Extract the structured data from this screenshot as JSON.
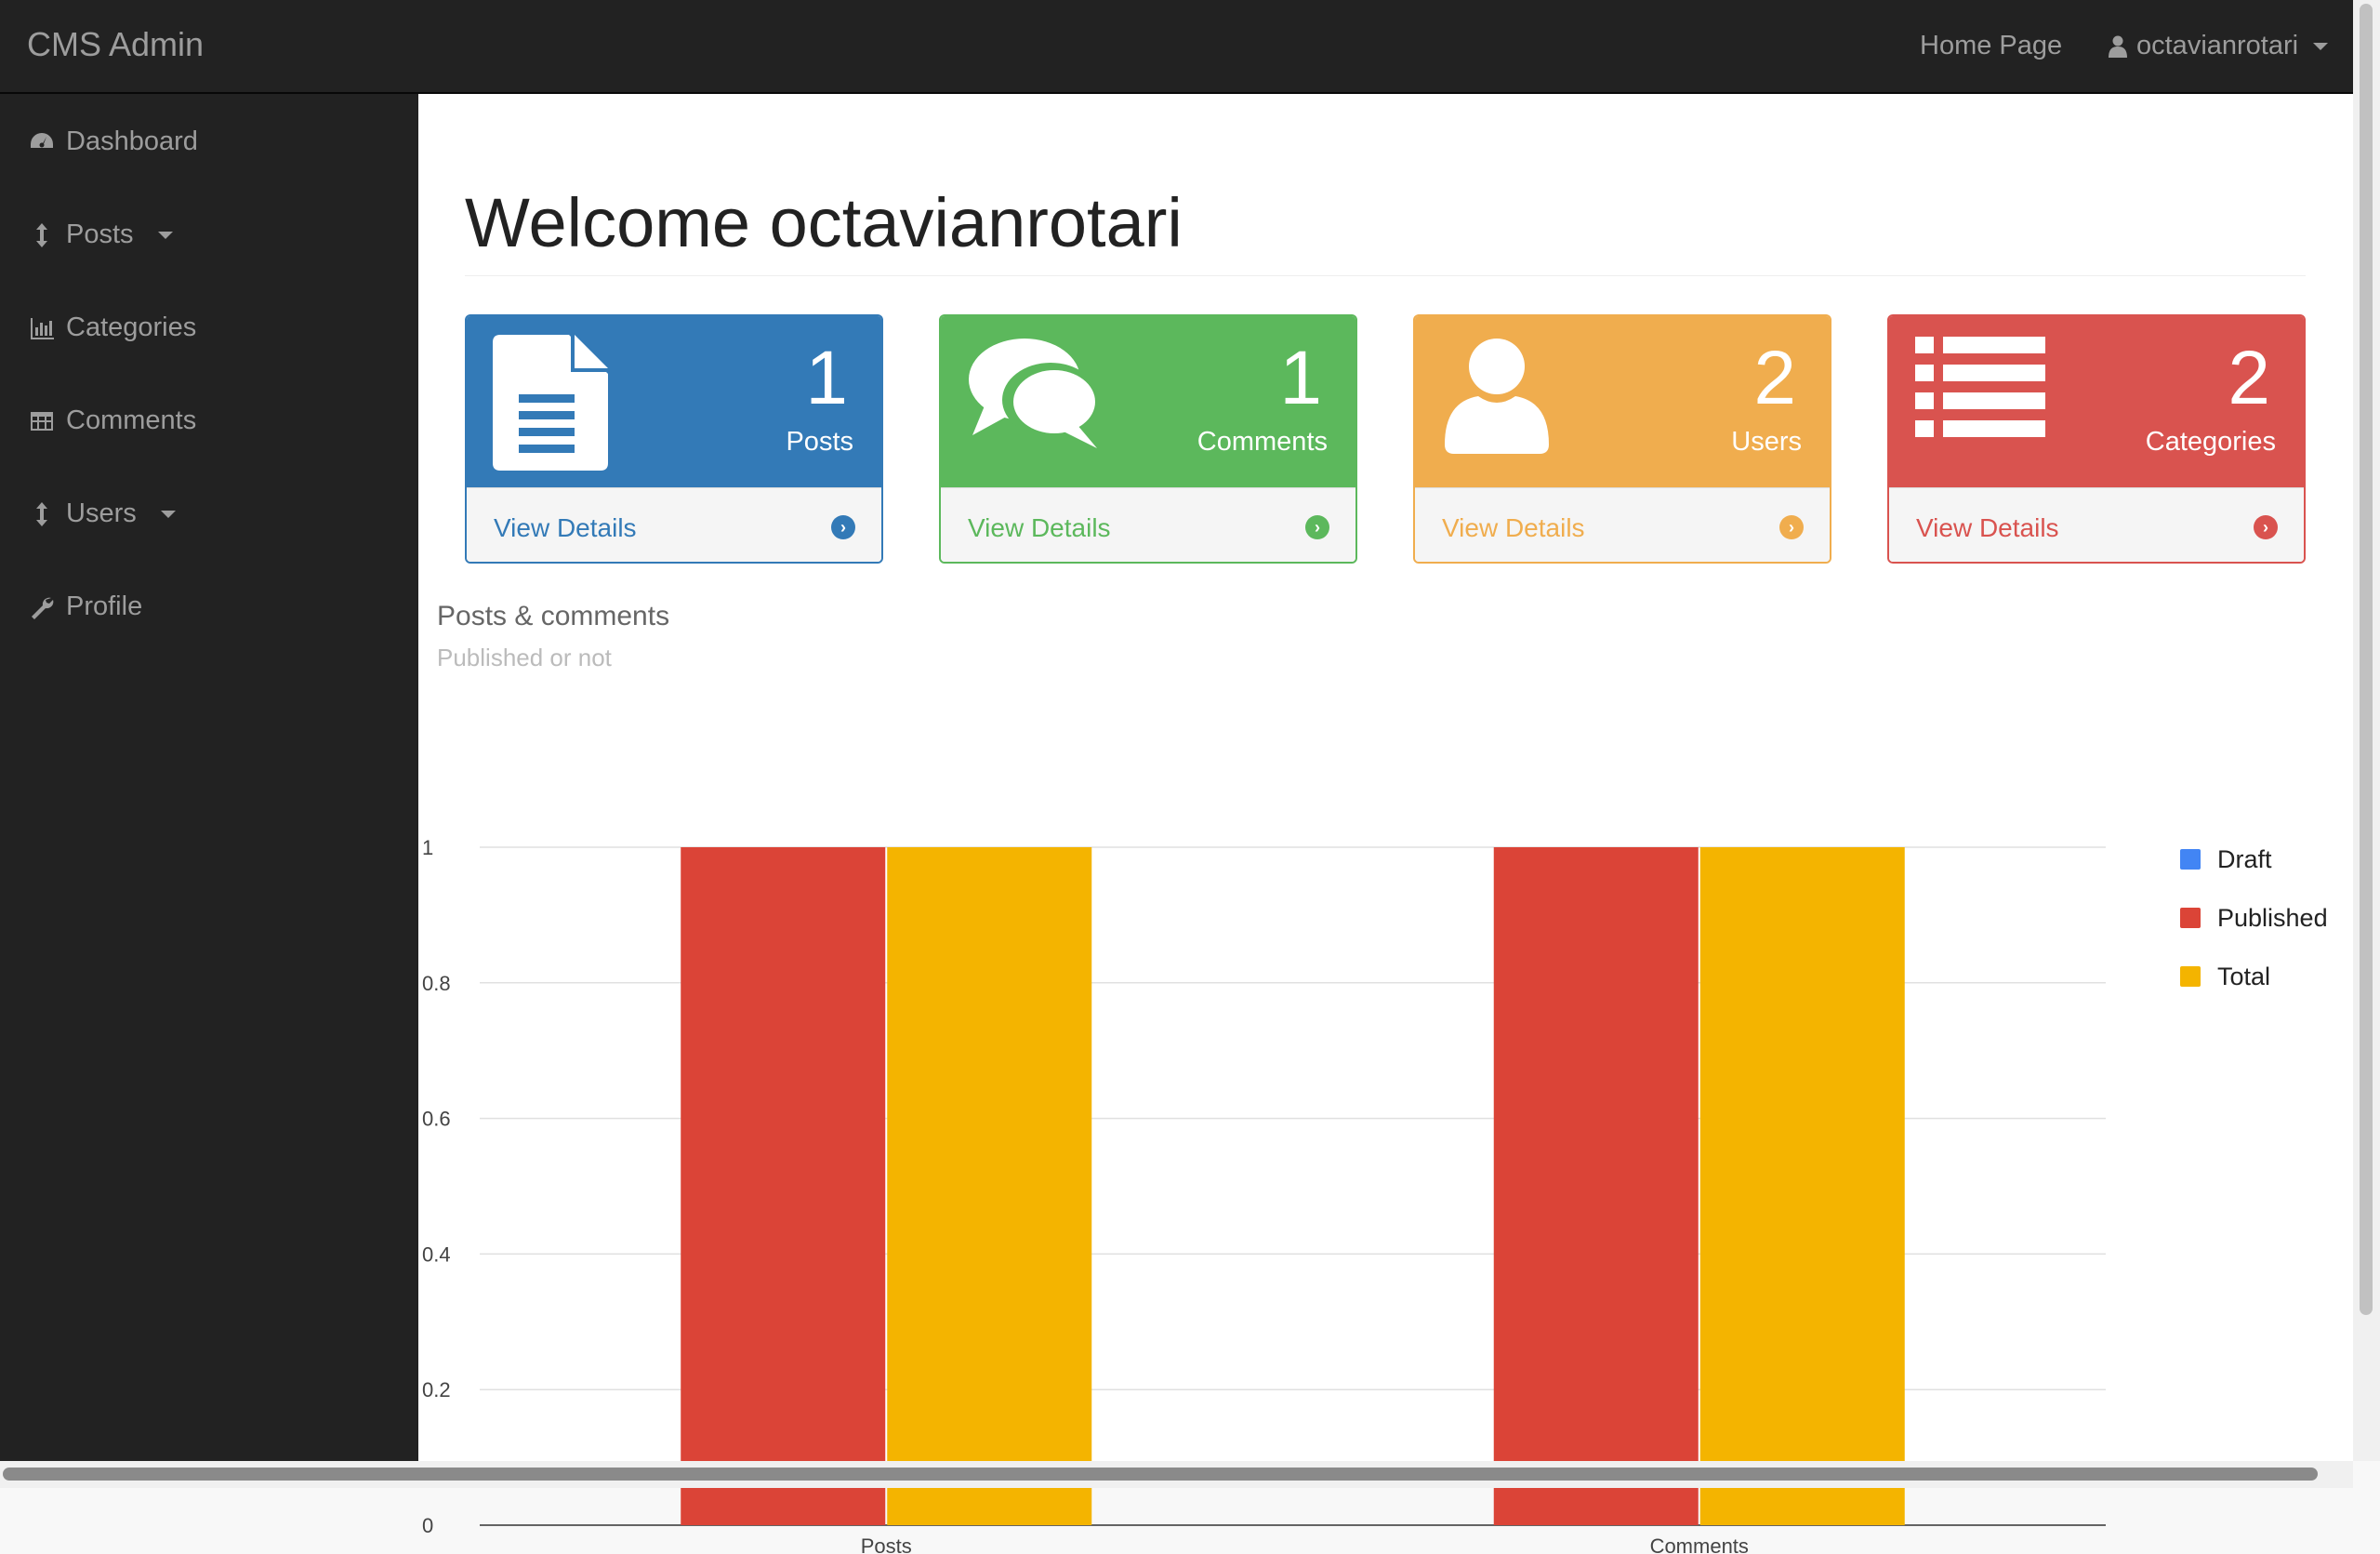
{
  "navbar": {
    "brand": "CMS Admin",
    "home_link": "Home Page",
    "user_menu": "octavianrotari"
  },
  "sidebar": {
    "items": [
      {
        "label": "Dashboard",
        "icon": "dashboard-icon"
      },
      {
        "label": "Posts",
        "icon": "vertical-arrows-icon",
        "dropdown": true
      },
      {
        "label": "Categories",
        "icon": "bar-chart-icon"
      },
      {
        "label": "Comments",
        "icon": "table-icon"
      },
      {
        "label": "Users",
        "icon": "vertical-arrows-icon",
        "dropdown": true
      },
      {
        "label": "Profile",
        "icon": "wrench-icon"
      }
    ]
  },
  "main": {
    "welcome": "Welcome octavianrotari",
    "panels": [
      {
        "count": "1",
        "label": "Posts",
        "link": "View Details",
        "color": "#337ab7",
        "icon": "file-icon"
      },
      {
        "count": "1",
        "label": "Comments",
        "link": "View Details",
        "color": "#5cb85c",
        "icon": "comments-icon"
      },
      {
        "count": "2",
        "label": "Users",
        "link": "View Details",
        "color": "#f0ad4e",
        "icon": "user-icon"
      },
      {
        "count": "2",
        "label": "Categories",
        "link": "View Details",
        "color": "#d9534f",
        "icon": "list-icon"
      }
    ]
  },
  "chart_data": {
    "type": "bar",
    "title": "Posts & comments",
    "subtitle": "Published or not",
    "categories": [
      "Posts",
      "Comments"
    ],
    "series": [
      {
        "name": "Draft",
        "values": [
          0,
          0
        ],
        "color": "#4285f4"
      },
      {
        "name": "Published",
        "values": [
          1,
          1
        ],
        "color": "#db4437"
      },
      {
        "name": "Total",
        "values": [
          1,
          1
        ],
        "color": "#f4b400"
      }
    ],
    "ylim": [
      0,
      1
    ],
    "yticks": [
      "0",
      "0.2",
      "0.4",
      "0.6",
      "0.8",
      "1"
    ],
    "grid": true,
    "legend_position": "right"
  }
}
